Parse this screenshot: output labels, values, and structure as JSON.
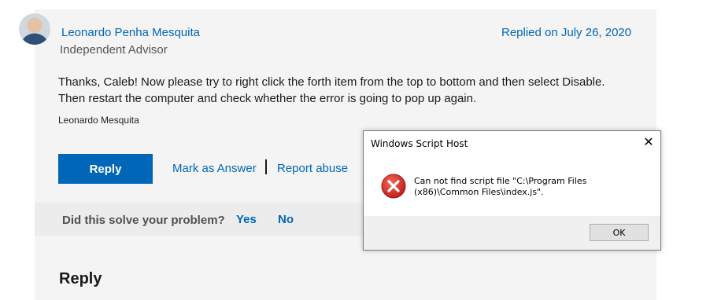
{
  "post": {
    "author": "Leonardo Penha Mesquita",
    "role": "Independent Advisor",
    "replied": "Replied on July 26, 2020",
    "body_line1": "Thanks, Caleb! Now please try to right click the forth item from the top to bottom and then select Disable.",
    "body_line2": "Then restart the computer and check whether the error is going to pop up again.",
    "signature": "Leonardo Mesquita"
  },
  "actions": {
    "reply": "Reply",
    "mark_answer": "Mark as Answer",
    "report_abuse": "Report abuse"
  },
  "feedback": {
    "question": "Did this solve your problem?",
    "yes": "Yes",
    "no": "No"
  },
  "reply_section": {
    "heading": "Reply"
  },
  "dialog": {
    "title": "Windows Script Host",
    "close_glyph": "✕",
    "message": "Can not find script file \"C:\\Program Files (x86)\\Common Files\\index.js\".",
    "ok": "OK",
    "icon": "error-icon"
  },
  "colors": {
    "link": "#0067b8",
    "button": "#0067b8",
    "card": "#f4f4f4",
    "error": "#d32f2f"
  }
}
